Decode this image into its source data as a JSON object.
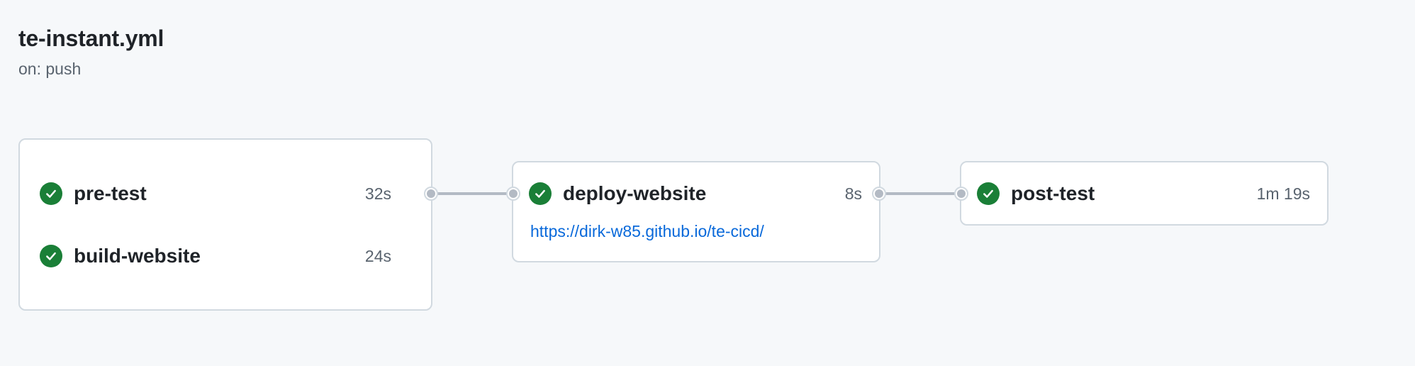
{
  "workflow": {
    "title": "te-instant.yml",
    "trigger": "on: push"
  },
  "colors": {
    "background": "#f6f8fa",
    "success": "#1a7f37",
    "link": "#0969da",
    "connector": "#b3bac4",
    "border": "#d1d9e0"
  },
  "jobs": [
    {
      "name": "pre-test",
      "duration": "32s",
      "status": "success",
      "icon": "check-circle-icon"
    },
    {
      "name": "build-website",
      "duration": "24s",
      "status": "success",
      "icon": "check-circle-icon"
    },
    {
      "name": "deploy-website",
      "duration": "8s",
      "status": "success",
      "icon": "check-circle-icon",
      "url": "https://dirk-w85.github.io/te-cicd/"
    },
    {
      "name": "post-test",
      "duration": "1m 19s",
      "status": "success",
      "icon": "check-circle-icon"
    }
  ]
}
